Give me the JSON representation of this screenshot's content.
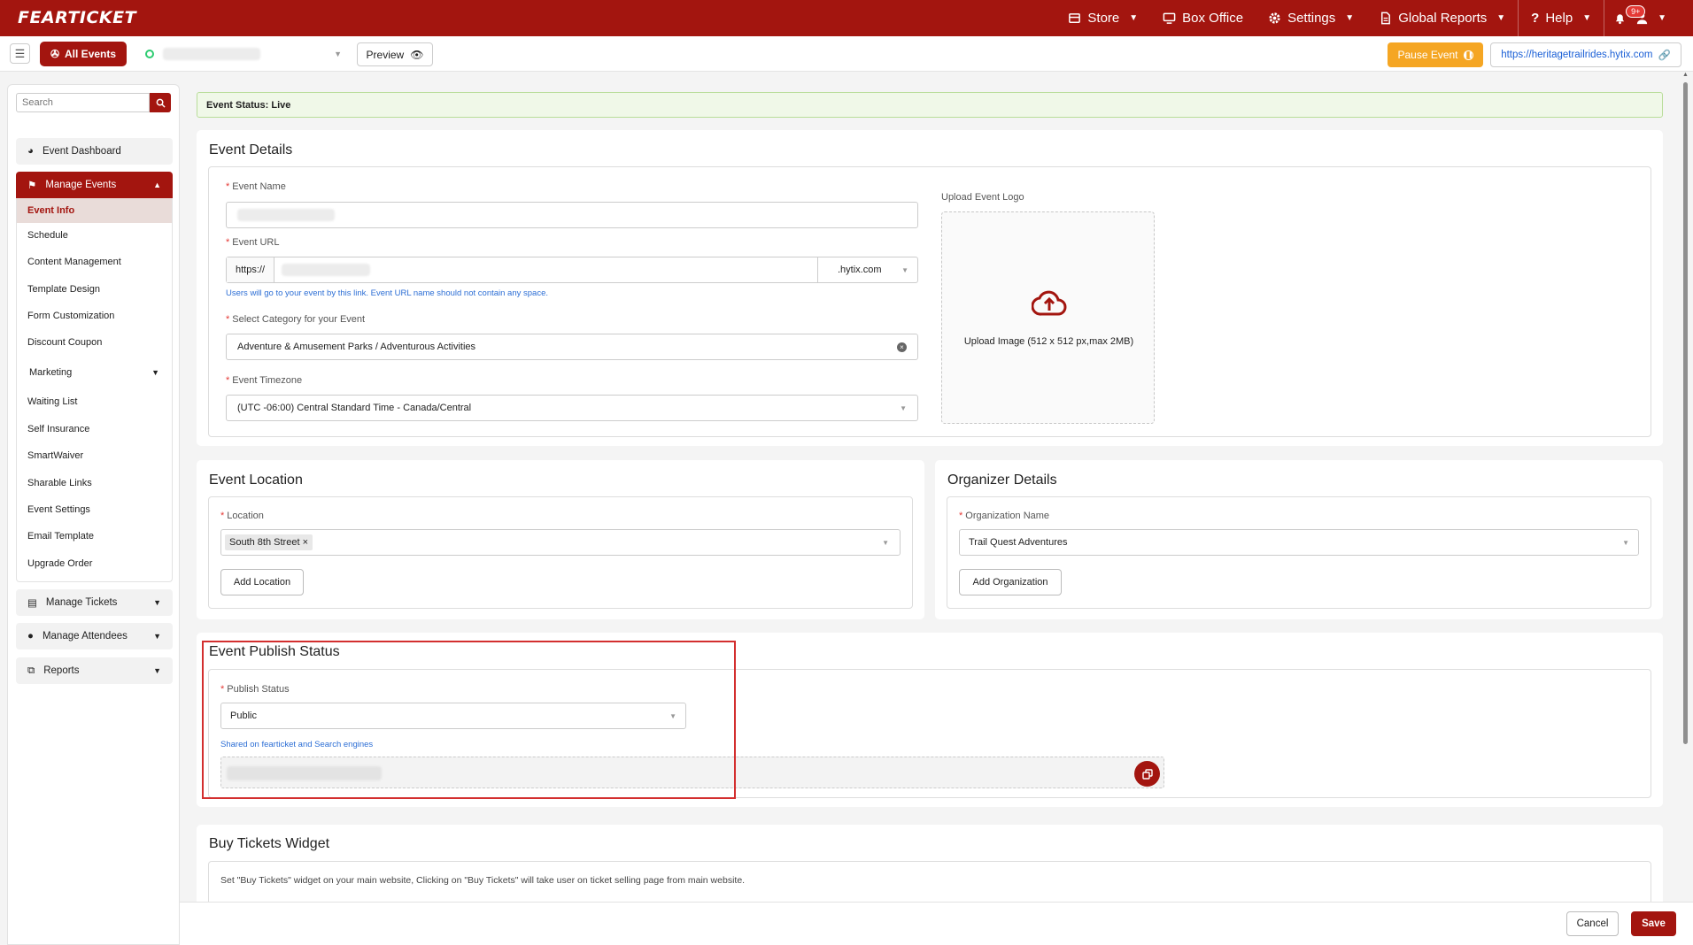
{
  "app": {
    "logo_text": "FEARTICKET",
    "brand_color": "#a3150f",
    "accent_color": "#f5a623"
  },
  "topnav": {
    "items": [
      {
        "label": "Store",
        "icon": "store-icon"
      },
      {
        "label": "Box Office",
        "icon": "monitor-icon"
      },
      {
        "label": "Settings",
        "icon": "gear-icon"
      },
      {
        "label": "Global Reports",
        "icon": "report-icon"
      },
      {
        "label": "Help",
        "icon": "question-icon"
      }
    ],
    "notification_badge": "9+"
  },
  "subbar": {
    "all_events_label": "All Events",
    "preview_label": "Preview",
    "pause_label": "Pause Event",
    "site_url": "https://heritagetrailrides.hytix.com"
  },
  "sidebar": {
    "search_placeholder": "Search",
    "event_dashboard": "Event Dashboard",
    "manage_events": "Manage Events",
    "sub_items": [
      "Event Info",
      "Schedule",
      "Content Management",
      "Template Design",
      "Form Customization",
      "Discount Coupon",
      "Marketing",
      "Waiting List",
      "Self Insurance",
      "SmartWaiver",
      "Sharable Links",
      "Event Settings",
      "Email Template",
      "Upgrade Order"
    ],
    "manage_tickets": "Manage Tickets",
    "manage_attendees": "Manage Attendees",
    "reports": "Reports"
  },
  "status_banner": "Event Status: Live",
  "event_details": {
    "title": "Event Details",
    "event_name_label": "Event Name",
    "event_url_label": "Event URL",
    "url_prefix": "https://",
    "url_suffix": ".hytix.com",
    "url_hint": "Users will go to your event by this link. Event URL name should not contain any space.",
    "category_label": "Select Category for your Event",
    "category_value": "Adventure & Amusement Parks / Adventurous Activities",
    "timezone_label": "Event Timezone",
    "timezone_value": "(UTC -06:00) Central Standard Time - Canada/Central",
    "upload_logo_label": "Upload Event Logo",
    "upload_text": "Upload Image (512 x 512 px,max 2MB)"
  },
  "event_location": {
    "title": "Event Location",
    "location_label": "Location",
    "location_chip": "South 8th Street",
    "add_location": "Add Location"
  },
  "organizer": {
    "title": "Organizer Details",
    "org_label": "Organization Name",
    "org_value": "Trail Quest Adventures",
    "add_org": "Add Organization"
  },
  "publish": {
    "title": "Event Publish Status",
    "status_label": "Publish Status",
    "status_value": "Public",
    "hint": "Shared on fearticket and Search engines"
  },
  "widget": {
    "title": "Buy Tickets Widget",
    "description": "Set \"Buy Tickets\" widget on your main website, Clicking on \"Buy Tickets\" will take user on ticket selling page from main website."
  },
  "footer": {
    "cancel": "Cancel",
    "save": "Save"
  }
}
